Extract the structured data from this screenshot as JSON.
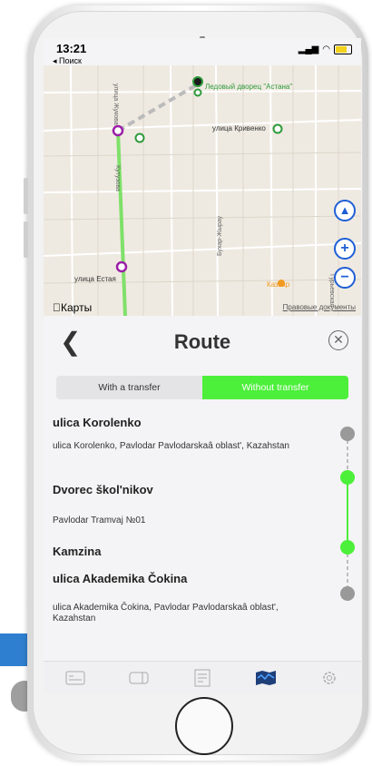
{
  "status_bar": {
    "time": "13:21",
    "back_label": "◂ Поиск"
  },
  "map": {
    "places": [
      {
        "label": "Ледовый дворец \"Астана\""
      },
      {
        "label": "улица Кривенко"
      },
      {
        "label": "улица Естая"
      },
      {
        "label": "Каззар"
      },
      {
        "label": "улица Жукова"
      },
      {
        "label": "Бухар-Жырау"
      },
      {
        "label": "Кутузова"
      },
      {
        "label": "Гурьевская"
      }
    ],
    "brand": "Карты",
    "legal": "Правовые документы"
  },
  "route": {
    "title": "Route",
    "segment": {
      "with_transfer": "With a transfer",
      "without_transfer": "Without transfer"
    },
    "stops": [
      {
        "name": "ulica Korolenko",
        "address": "ulica Korolenko, Pavlodar Pavlodarskaâ oblast', Kazahstan"
      },
      {
        "name": "Dvorec škol'nikov",
        "address": "Pavlodar Tramvaj №01"
      },
      {
        "name": "Kamzina"
      },
      {
        "name": "ulica Akademika Čokina",
        "address": "ulica Akademika Čokina, Pavlodar Pavlodarskaâ oblast', Kazahstan"
      }
    ]
  },
  "colors": {
    "accent": "#4cef3a",
    "route_line": "#7fe06a",
    "stop_gray": "#999999",
    "map_blue": "#1e5fd6"
  },
  "tabbar": {
    "items": [
      "card-icon",
      "ticket-icon",
      "receipt-icon",
      "map-icon",
      "gear-icon"
    ]
  }
}
